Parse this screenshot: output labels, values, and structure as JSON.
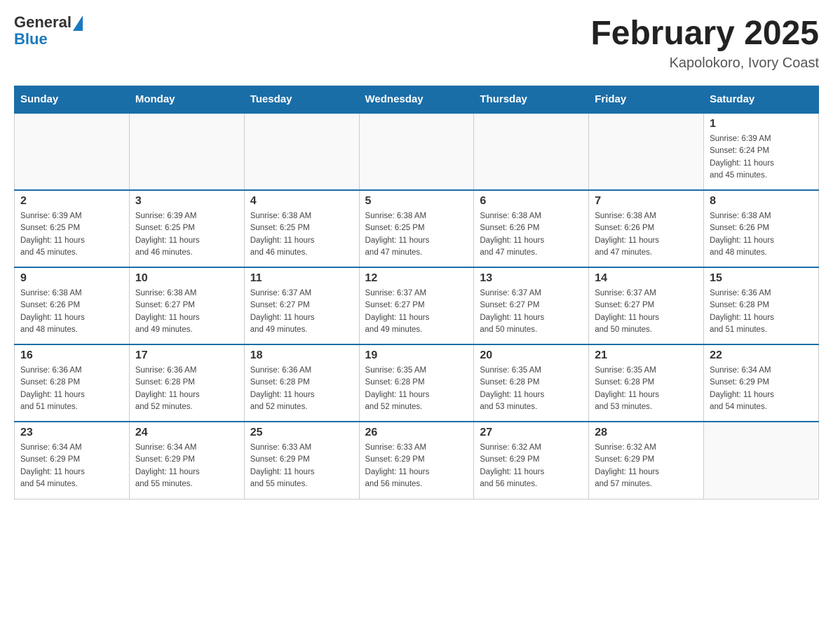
{
  "header": {
    "logo_general": "General",
    "logo_blue": "Blue",
    "month_title": "February 2025",
    "location": "Kapolokoro, Ivory Coast"
  },
  "weekdays": [
    "Sunday",
    "Monday",
    "Tuesday",
    "Wednesday",
    "Thursday",
    "Friday",
    "Saturday"
  ],
  "weeks": [
    [
      {
        "day": "",
        "info": ""
      },
      {
        "day": "",
        "info": ""
      },
      {
        "day": "",
        "info": ""
      },
      {
        "day": "",
        "info": ""
      },
      {
        "day": "",
        "info": ""
      },
      {
        "day": "",
        "info": ""
      },
      {
        "day": "1",
        "info": "Sunrise: 6:39 AM\nSunset: 6:24 PM\nDaylight: 11 hours\nand 45 minutes."
      }
    ],
    [
      {
        "day": "2",
        "info": "Sunrise: 6:39 AM\nSunset: 6:25 PM\nDaylight: 11 hours\nand 45 minutes."
      },
      {
        "day": "3",
        "info": "Sunrise: 6:39 AM\nSunset: 6:25 PM\nDaylight: 11 hours\nand 46 minutes."
      },
      {
        "day": "4",
        "info": "Sunrise: 6:38 AM\nSunset: 6:25 PM\nDaylight: 11 hours\nand 46 minutes."
      },
      {
        "day": "5",
        "info": "Sunrise: 6:38 AM\nSunset: 6:25 PM\nDaylight: 11 hours\nand 47 minutes."
      },
      {
        "day": "6",
        "info": "Sunrise: 6:38 AM\nSunset: 6:26 PM\nDaylight: 11 hours\nand 47 minutes."
      },
      {
        "day": "7",
        "info": "Sunrise: 6:38 AM\nSunset: 6:26 PM\nDaylight: 11 hours\nand 47 minutes."
      },
      {
        "day": "8",
        "info": "Sunrise: 6:38 AM\nSunset: 6:26 PM\nDaylight: 11 hours\nand 48 minutes."
      }
    ],
    [
      {
        "day": "9",
        "info": "Sunrise: 6:38 AM\nSunset: 6:26 PM\nDaylight: 11 hours\nand 48 minutes."
      },
      {
        "day": "10",
        "info": "Sunrise: 6:38 AM\nSunset: 6:27 PM\nDaylight: 11 hours\nand 49 minutes."
      },
      {
        "day": "11",
        "info": "Sunrise: 6:37 AM\nSunset: 6:27 PM\nDaylight: 11 hours\nand 49 minutes."
      },
      {
        "day": "12",
        "info": "Sunrise: 6:37 AM\nSunset: 6:27 PM\nDaylight: 11 hours\nand 49 minutes."
      },
      {
        "day": "13",
        "info": "Sunrise: 6:37 AM\nSunset: 6:27 PM\nDaylight: 11 hours\nand 50 minutes."
      },
      {
        "day": "14",
        "info": "Sunrise: 6:37 AM\nSunset: 6:27 PM\nDaylight: 11 hours\nand 50 minutes."
      },
      {
        "day": "15",
        "info": "Sunrise: 6:36 AM\nSunset: 6:28 PM\nDaylight: 11 hours\nand 51 minutes."
      }
    ],
    [
      {
        "day": "16",
        "info": "Sunrise: 6:36 AM\nSunset: 6:28 PM\nDaylight: 11 hours\nand 51 minutes."
      },
      {
        "day": "17",
        "info": "Sunrise: 6:36 AM\nSunset: 6:28 PM\nDaylight: 11 hours\nand 52 minutes."
      },
      {
        "day": "18",
        "info": "Sunrise: 6:36 AM\nSunset: 6:28 PM\nDaylight: 11 hours\nand 52 minutes."
      },
      {
        "day": "19",
        "info": "Sunrise: 6:35 AM\nSunset: 6:28 PM\nDaylight: 11 hours\nand 52 minutes."
      },
      {
        "day": "20",
        "info": "Sunrise: 6:35 AM\nSunset: 6:28 PM\nDaylight: 11 hours\nand 53 minutes."
      },
      {
        "day": "21",
        "info": "Sunrise: 6:35 AM\nSunset: 6:28 PM\nDaylight: 11 hours\nand 53 minutes."
      },
      {
        "day": "22",
        "info": "Sunrise: 6:34 AM\nSunset: 6:29 PM\nDaylight: 11 hours\nand 54 minutes."
      }
    ],
    [
      {
        "day": "23",
        "info": "Sunrise: 6:34 AM\nSunset: 6:29 PM\nDaylight: 11 hours\nand 54 minutes."
      },
      {
        "day": "24",
        "info": "Sunrise: 6:34 AM\nSunset: 6:29 PM\nDaylight: 11 hours\nand 55 minutes."
      },
      {
        "day": "25",
        "info": "Sunrise: 6:33 AM\nSunset: 6:29 PM\nDaylight: 11 hours\nand 55 minutes."
      },
      {
        "day": "26",
        "info": "Sunrise: 6:33 AM\nSunset: 6:29 PM\nDaylight: 11 hours\nand 56 minutes."
      },
      {
        "day": "27",
        "info": "Sunrise: 6:32 AM\nSunset: 6:29 PM\nDaylight: 11 hours\nand 56 minutes."
      },
      {
        "day": "28",
        "info": "Sunrise: 6:32 AM\nSunset: 6:29 PM\nDaylight: 11 hours\nand 57 minutes."
      },
      {
        "day": "",
        "info": ""
      }
    ]
  ]
}
